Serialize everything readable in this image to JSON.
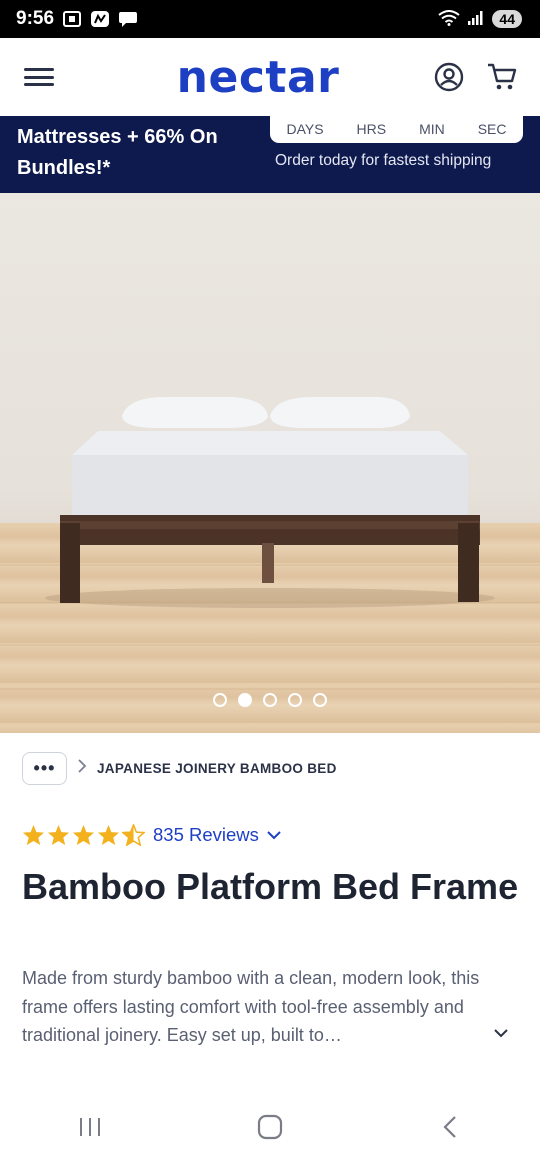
{
  "status_bar": {
    "time": "9:56",
    "battery": "44",
    "icons": [
      "screenshot-icon",
      "news-icon",
      "chat-icon",
      "wifi-icon",
      "signal-icon"
    ]
  },
  "header": {
    "logo": "nectar",
    "icons": [
      "menu-icon",
      "account-icon",
      "cart-icon"
    ],
    "brand_color": "#1d3fc4"
  },
  "promo": {
    "title": "Mattresses + 66% On Bundles!*",
    "countdown_labels": [
      "DAYS",
      "HRS",
      "MIN",
      "SEC"
    ],
    "subtitle": "Order today for fastest shipping",
    "background": "#0e1a4d"
  },
  "hero": {
    "slide_count": 5,
    "active_slide": 2
  },
  "breadcrumb": {
    "more": "•••",
    "current": "JAPANESE JOINERY BAMBOO BED"
  },
  "rating": {
    "stars": 4.5,
    "reviews": "835 Reviews",
    "star_color": "#f2b11d"
  },
  "product": {
    "title": "Bamboo Platform Bed Frame",
    "description": "Made from sturdy bamboo with a clean, modern look, this frame offers lasting comfort with tool-free assembly and traditional joinery. Easy set up, built to…"
  },
  "navbar": {
    "icons": [
      "recent-apps-icon",
      "home-icon",
      "back-icon"
    ]
  }
}
